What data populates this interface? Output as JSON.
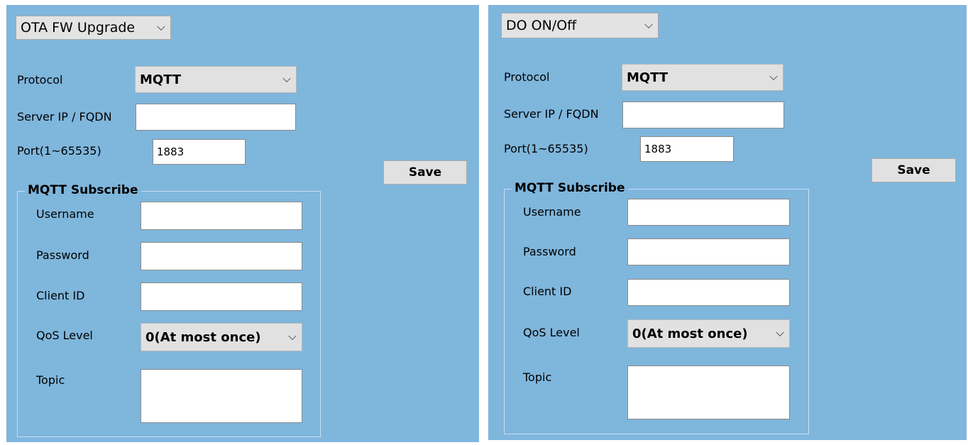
{
  "left_panel": {
    "mode_select": "OTA FW Upgrade",
    "protocol_label": "Protocol",
    "protocol_value": "MQTT",
    "server_label": "Server IP / FQDN",
    "server_value": "",
    "port_label": "Port(1~65535)",
    "port_value": "1883",
    "save_label": "Save",
    "group_title": "MQTT Subscribe",
    "username_label": "Username",
    "username_value": "",
    "password_label": "Password",
    "password_value": "",
    "clientid_label": "Client ID",
    "clientid_value": "",
    "qos_label": "QoS Level",
    "qos_value": "0(At most once)",
    "topic_label": "Topic",
    "topic_value": ""
  },
  "right_panel": {
    "mode_select": "DO ON/Off",
    "protocol_label": "Protocol",
    "protocol_value": "MQTT",
    "server_label": "Server IP / FQDN",
    "server_value": "",
    "port_label": "Port(1~65535)",
    "port_value": "1883",
    "save_label": "Save",
    "group_title": "MQTT Subscribe",
    "username_label": "Username",
    "username_value": "",
    "password_label": "Password",
    "password_value": "",
    "clientid_label": "Client ID",
    "clientid_value": "",
    "qos_label": "QoS Level",
    "qos_value": "0(At most once)",
    "topic_label": "Topic",
    "topic_value": ""
  },
  "colors": {
    "panel_background": "#7fb6dc",
    "control_background": "#e1e1e1",
    "input_background": "#ffffff"
  }
}
